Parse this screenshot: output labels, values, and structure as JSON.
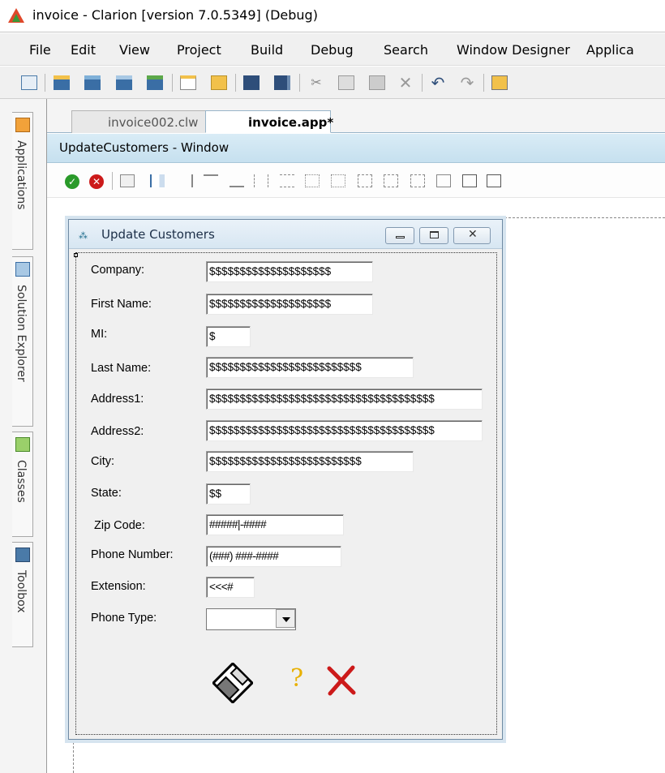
{
  "titlebar": {
    "title": "invoice - Clarion [version 7.0.5349] (Debug)"
  },
  "menu": [
    {
      "label": "File"
    },
    {
      "label": "Edit"
    },
    {
      "label": "View"
    },
    {
      "label": "Project"
    },
    {
      "label": "Build"
    },
    {
      "label": "Debug"
    },
    {
      "label": "Search"
    },
    {
      "label": "Window Designer"
    },
    {
      "label": "Applica"
    }
  ],
  "side_tabs": [
    {
      "label": "Applications"
    },
    {
      "label": "Solution Explorer"
    },
    {
      "label": "Classes"
    },
    {
      "label": "Toolbox"
    }
  ],
  "doc_tabs": [
    {
      "label": "invoice002.clw"
    },
    {
      "label": "invoice.app*"
    }
  ],
  "designer": {
    "header": "UpdateCustomers - Window"
  },
  "form": {
    "title": "Update Customers",
    "fields": [
      {
        "label": "Company:",
        "value": "$$$$$$$$$$$$$$$$$$$$"
      },
      {
        "label": "First Name:",
        "value": "$$$$$$$$$$$$$$$$$$$$"
      },
      {
        "label": "MI:",
        "value": "$"
      },
      {
        "label": "Last Name:",
        "value": "$$$$$$$$$$$$$$$$$$$$$$$$$"
      },
      {
        "label": "Address1:",
        "value": "$$$$$$$$$$$$$$$$$$$$$$$$$$$$$$$$$$$$$"
      },
      {
        "label": "Address2:",
        "value": "$$$$$$$$$$$$$$$$$$$$$$$$$$$$$$$$$$$$$"
      },
      {
        "label": "City:",
        "value": "$$$$$$$$$$$$$$$$$$$$$$$$$"
      },
      {
        "label": "State:",
        "value": "$$"
      },
      {
        "label": "Zip Code:",
        "value": "#####|-####"
      },
      {
        "label": "Phone Number:",
        "value": "(###) ###-####"
      },
      {
        "label": "Extension:",
        "value": "<<<#"
      },
      {
        "label": "Phone Type:",
        "value": ""
      }
    ]
  },
  "colors": {
    "accent_title": "#d7e6f2",
    "cancel_red": "#cc1a1a",
    "ok_green": "#2a9a2a"
  }
}
